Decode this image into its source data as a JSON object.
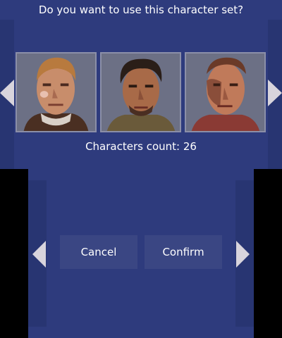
{
  "dialog": {
    "question": "Do you want to use this character set?",
    "characters_count_label": "Characters count: 26"
  },
  "portraits": [
    {
      "icon": "character-portrait-blond-man"
    },
    {
      "icon": "character-portrait-dark-haired-man"
    },
    {
      "icon": "character-portrait-scarred-man"
    }
  ],
  "buttons": {
    "cancel_label": "Cancel",
    "confirm_label": "Confirm"
  },
  "colors": {
    "panel": "#2e3b7d",
    "button": "#3a4683",
    "arrow": "#d8d4dc"
  }
}
